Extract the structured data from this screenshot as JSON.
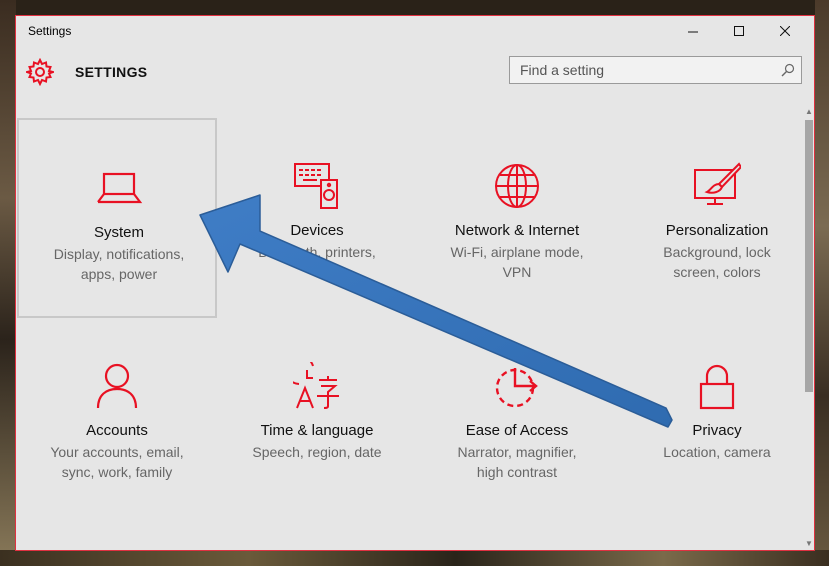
{
  "window": {
    "title": "Settings",
    "controls": {
      "minimize": "—",
      "maximize": "☐",
      "close": "✕"
    }
  },
  "header": {
    "title": "SETTINGS",
    "icon": "gear-icon",
    "search_placeholder": "Find a setting"
  },
  "accent_color": "#e81123",
  "tiles": [
    {
      "name": "System",
      "desc_line1": "Display, notifications,",
      "desc_line2": "apps, power",
      "icon": "laptop-icon"
    },
    {
      "name": "Devices",
      "desc_line1": "Bluetooth, printers,",
      "desc_line2": "",
      "icon": "devices-icon"
    },
    {
      "name": "Network & Internet",
      "desc_line1": "Wi-Fi, airplane mode,",
      "desc_line2": "VPN",
      "icon": "globe-icon"
    },
    {
      "name": "Personalization",
      "desc_line1": "Background, lock",
      "desc_line2": "screen, colors",
      "icon": "paint-icon"
    },
    {
      "name": "Accounts",
      "desc_line1": "Your accounts, email,",
      "desc_line2": "sync, work, family",
      "icon": "person-icon"
    },
    {
      "name": "Time & language",
      "desc_line1": "Speech, region, date",
      "desc_line2": "",
      "icon": "time-language-icon"
    },
    {
      "name": "Ease of Access",
      "desc_line1": "Narrator, magnifier,",
      "desc_line2": "high contrast",
      "icon": "ease-of-access-icon"
    },
    {
      "name": "Privacy",
      "desc_line1": "Location, camera",
      "desc_line2": "",
      "icon": "lock-icon"
    }
  ],
  "annotation": {
    "type": "arrow",
    "color": "#3a78c0",
    "points_to": "System"
  }
}
